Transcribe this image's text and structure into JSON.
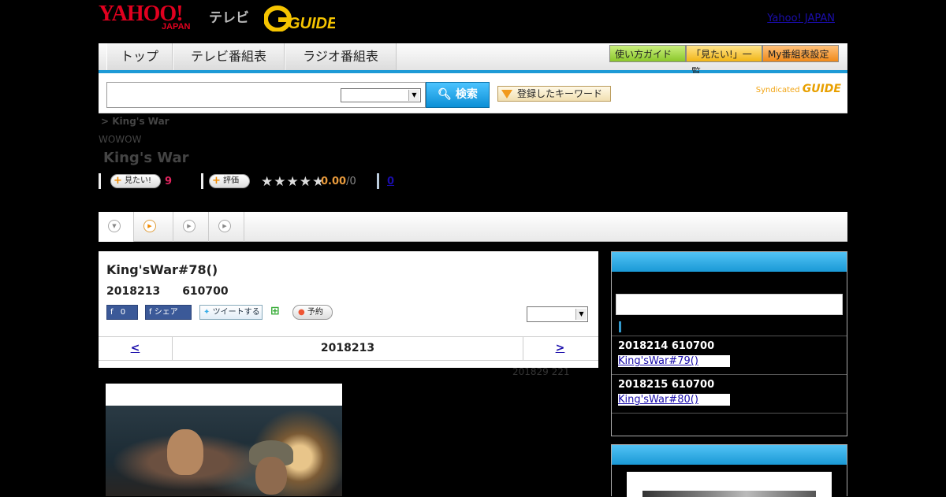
{
  "header": {
    "yahoo_logo": "YAHOO!",
    "japan_logo": "JAPAN",
    "tv_label": "テレビ",
    "gguide_logo": "G-GUIDE",
    "yahoo_japan_link": "Yahoo! JAPAN"
  },
  "nav": {
    "tabs": [
      "トップ",
      "テレビ番組表",
      "ラジオ番組表"
    ],
    "tools": [
      "使い方ガイド",
      "「見たい!」一覧",
      "My番組表設定"
    ]
  },
  "search": {
    "button": "検索",
    "keyword_button": "登録したキーワード",
    "syndicated": "Syndicated",
    "syndicated_brand": "GUIDE"
  },
  "program": {
    "breadcrumb": "> King's War",
    "station": "WOWOW",
    "title": "King's War",
    "want_label": "見たい!",
    "want_count": "9",
    "rate_label": "評価",
    "stars": "★★★★★",
    "score": "0.00",
    "score_count": "/0",
    "review_count": "0"
  },
  "episode": {
    "title": "King'sWar#78()",
    "date": "2018213　　610700",
    "fb_count": "0",
    "fb_share": "シェア",
    "tweet": "ツイートする",
    "reserve": "予約",
    "pager_prev": "<",
    "pager_date": "2018213",
    "pager_next": ">",
    "updated": "201829  221"
  },
  "sidebar": {
    "items": [
      {
        "date": "2018214  610700",
        "link": "King'sWar#79()"
      },
      {
        "date": "2018215  610700",
        "link": "King'sWar#80()"
      }
    ]
  }
}
